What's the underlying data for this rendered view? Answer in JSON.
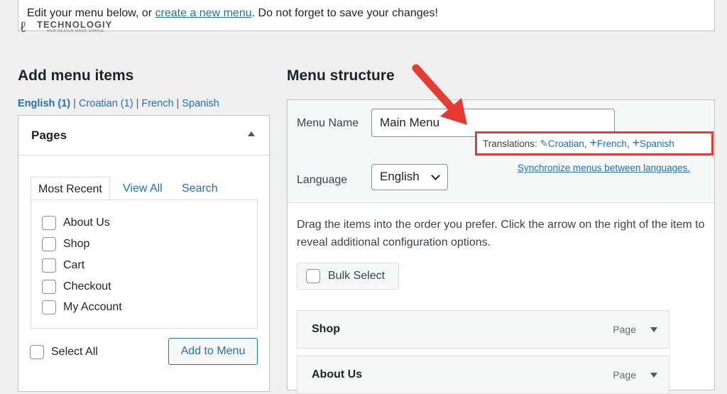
{
  "notice": {
    "text_before": "Edit your menu below, or ",
    "link": "create a new menu",
    "text_after": ". Do not forget to save your changes!"
  },
  "logo": {
    "name": "TECHNOLOGIY",
    "tagline": "WEB DESIGN MADE SIMPLE"
  },
  "add_items": {
    "heading": "Add menu items",
    "languages": [
      {
        "label": "English (1)",
        "current": true
      },
      {
        "label": "Croatian (1)"
      },
      {
        "label": "French"
      },
      {
        "label": "Spanish"
      }
    ],
    "separator": "|",
    "box_title": "Pages",
    "tabs": [
      "Most Recent",
      "View All",
      "Search"
    ],
    "pages": [
      "About Us",
      "Shop",
      "Cart",
      "Checkout",
      "My Account"
    ],
    "select_all": "Select All",
    "add_button": "Add to Menu"
  },
  "structure": {
    "heading": "Menu structure",
    "menu_name_label": "Menu Name",
    "menu_name_value": "Main Menu",
    "translations_label": "Translations:",
    "translations": [
      {
        "icon": "pencil-icon",
        "label": "Croatian"
      },
      {
        "icon": "plus-icon",
        "label": "French"
      },
      {
        "icon": "plus-icon",
        "label": "Spanish"
      }
    ],
    "sync_link": "Synchronize menus between languages.",
    "language_label": "Language",
    "language_value": "English",
    "instructions": "Drag the items into the order you prefer. Click the arrow on the right of the item to reveal additional configuration options.",
    "bulk_select": "Bulk Select",
    "items": [
      {
        "title": "Shop",
        "type": "Page"
      },
      {
        "title": "About Us",
        "type": "Page"
      }
    ]
  },
  "colors": {
    "accent": "#2271b1",
    "highlight": "#e53b35"
  }
}
